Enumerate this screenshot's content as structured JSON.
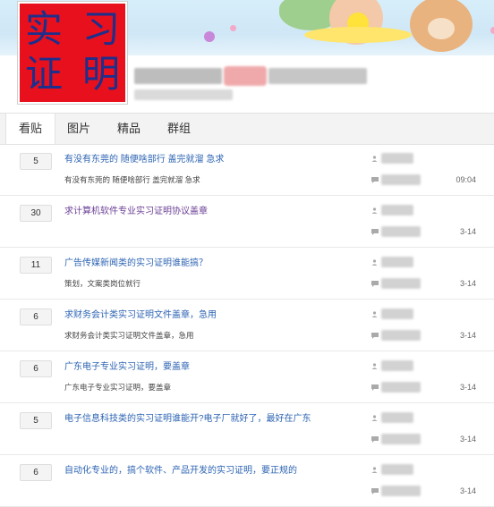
{
  "logo": {
    "chars": [
      "实",
      "习",
      "证",
      "明"
    ],
    "bg_color": "#e8101c",
    "text_color": "#1d2f8c"
  },
  "tabs": [
    {
      "label": "看贴",
      "active": true
    },
    {
      "label": "图片",
      "active": false
    },
    {
      "label": "精品",
      "active": false
    },
    {
      "label": "群组",
      "active": false
    }
  ],
  "threads": [
    {
      "count": "5",
      "title": "有没有东莞的 随便啥部行 盖完就溜 急求",
      "excerpt": "有没有东莞的 随便啥部行 盖完就溜 急求",
      "time": "09:04",
      "visited": false
    },
    {
      "count": "30",
      "title": "求计算机软件专业实习证明协议盖章",
      "excerpt": "",
      "time": "3-14",
      "visited": true
    },
    {
      "count": "11",
      "title": "广告传媒新闻类的实习证明谁能搞？",
      "excerpt": "策划，文案类岗位就行",
      "time": "3-14",
      "visited": false
    },
    {
      "count": "6",
      "title": "求财务会计类实习证明文件盖章，急用",
      "excerpt": "求财务会计类实习证明文件盖章，急用",
      "time": "3-14",
      "visited": false
    },
    {
      "count": "6",
      "title": "广东电子专业实习证明，要盖章",
      "excerpt": "广东电子专业实习证明，要盖章",
      "time": "3-14",
      "visited": false
    },
    {
      "count": "5",
      "title": "电子信息科技类的实习证明谁能开?电子厂就好了，最好在广东",
      "excerpt": "",
      "time": "3-14",
      "visited": false
    },
    {
      "count": "6",
      "title": "自动化专业的，搞个软件、产品开发的实习证明，要正规的",
      "excerpt": "",
      "time": "3-14",
      "visited": false
    }
  ],
  "colors": {
    "link": "#2d64b3",
    "visited": "#6b3f96",
    "tab_bar": "#f3f3f3"
  },
  "icons": {
    "user": "user-icon",
    "comment": "comment-icon"
  }
}
